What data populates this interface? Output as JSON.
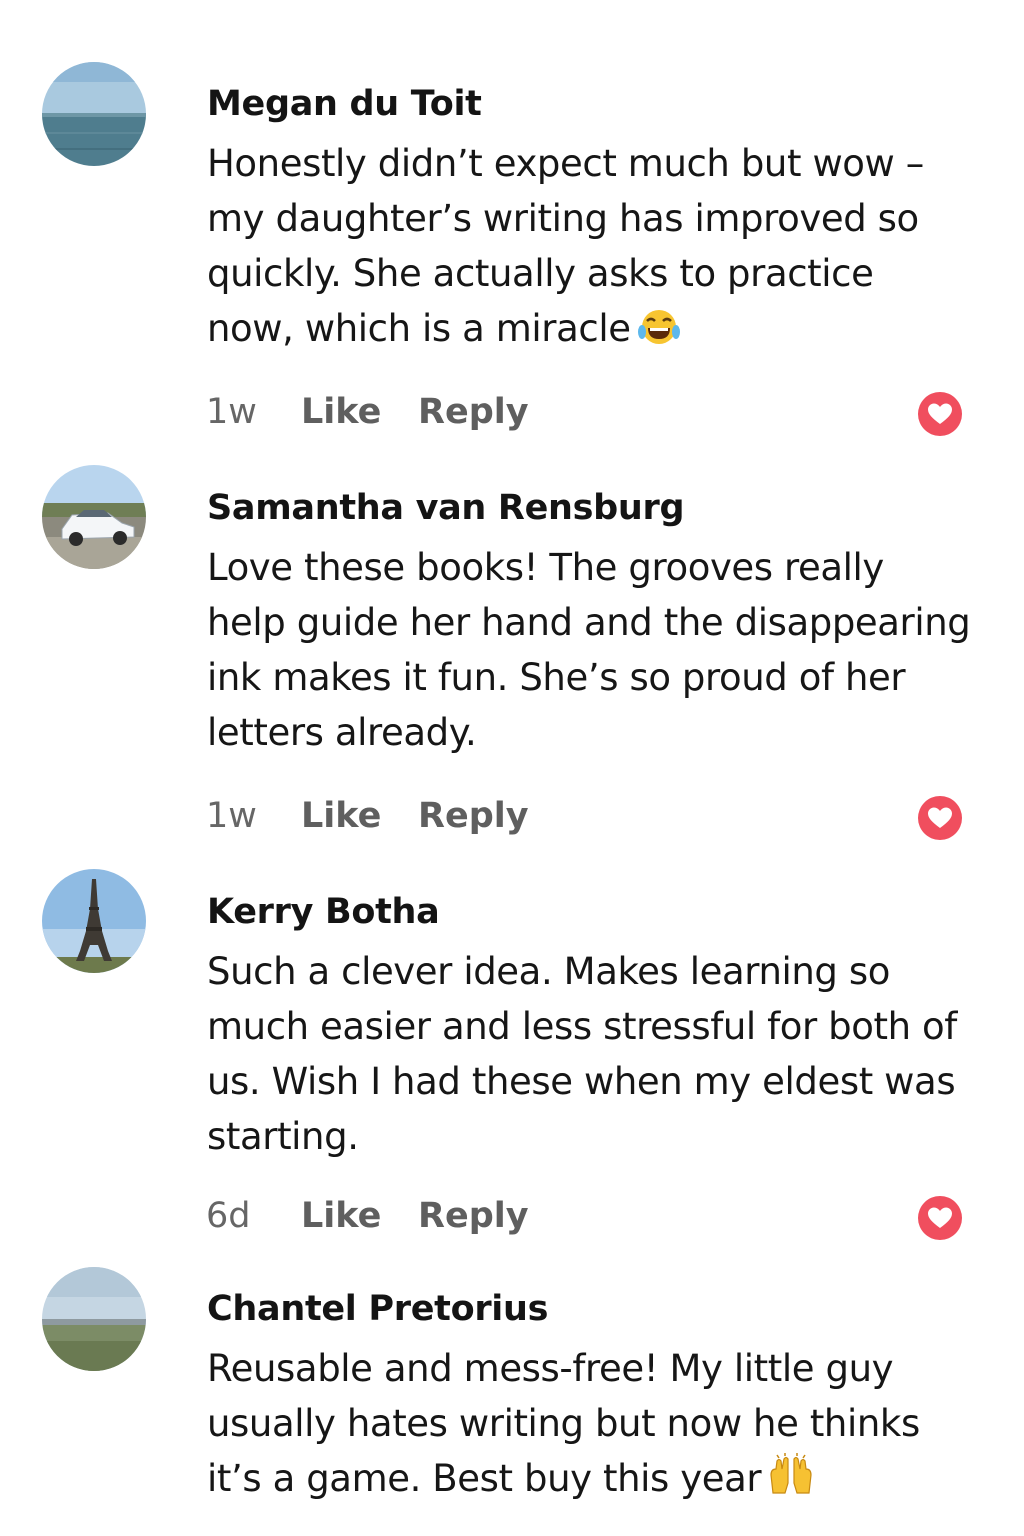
{
  "comments": [
    {
      "author": "Megan du Toit",
      "lines": [
        "Honestly didn’t expect much but wow –",
        "my daughter’s writing has improved so",
        "quickly. She actually asks to practice",
        "now, which is a miracle"
      ],
      "emoji": "laughing-tears-emoji",
      "time": "1w",
      "like_label": "Like",
      "reply_label": "Reply",
      "avatar": "ocean-horizon-photo"
    },
    {
      "author": "Samantha van Rensburg",
      "lines": [
        "Love these books! The grooves really",
        "help guide her hand and the disappearing",
        "ink makes it fun. She’s so proud of her",
        "letters already."
      ],
      "time": "1w",
      "like_label": "Like",
      "reply_label": "Reply",
      "avatar": "white-car-photo"
    },
    {
      "author": "Kerry Botha",
      "lines": [
        "Such a clever idea. Makes learning so",
        "much easier and less stressful for both of",
        "us. Wish I had these when my eldest was",
        "starting."
      ],
      "time": "6d",
      "like_label": "Like",
      "reply_label": "Reply",
      "avatar": "eiffel-tower-photo"
    },
    {
      "author": "Chantel Pretorius",
      "lines": [
        "Reusable and mess-free! My little guy",
        "usually hates writing but now he thinks",
        "it’s a game. Best buy this year"
      ],
      "emoji": "raising-hands-emoji",
      "avatar": "field-landscape-photo"
    }
  ],
  "colors": {
    "reaction_heart": "#f04e5e",
    "action_text": "#5f5f5f",
    "author_text": "#141414"
  },
  "icons": {
    "reaction": "heart-icon"
  }
}
